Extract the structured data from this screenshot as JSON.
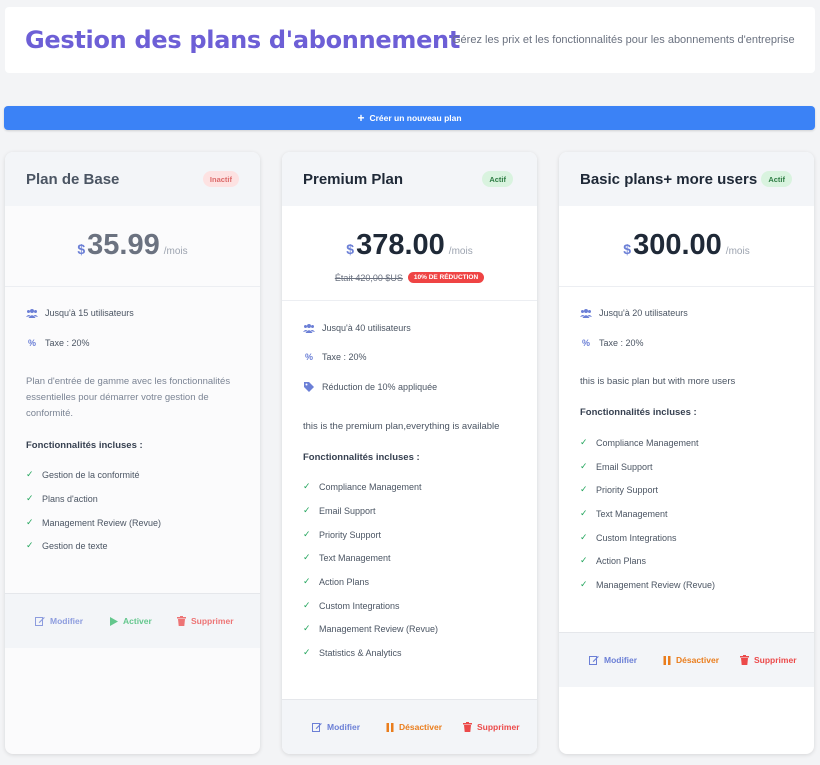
{
  "header": {
    "title": "Gestion des plans d'abonnement",
    "subtitle": "Gérez les prix et les fonctionnalités pour les abonnements d'entreprise"
  },
  "create_button": {
    "label": "Créer un nouveau plan",
    "icon": "plus-icon"
  },
  "labels": {
    "features_title": "Fonctionnalités incluses :",
    "edit": "Modifier",
    "activate": "Activer",
    "deactivate": "Désactiver",
    "delete": "Supprimer",
    "currency": "$",
    "per": "/mois"
  },
  "colors": {
    "accent": "#3b82f6",
    "title": "#6d5fd6",
    "active_badge": "#d9f3df",
    "inactive_badge": "#fde2e2",
    "discount": "#ef4444"
  },
  "plans": [
    {
      "name": "Plan de Base",
      "status": "Inactif",
      "price": "35.99",
      "users": "Jusqu'à 15 utilisateurs",
      "tax": "Taxe : 20%",
      "description": "Plan d'entrée de gamme avec les fonctionnalités essentielles pour démarrer votre gestion de conformité.",
      "features": [
        "Gestion de la conformité",
        "Plans d'action",
        "Management Review (Revue)",
        "Gestion de texte"
      ]
    },
    {
      "name": "Premium Plan",
      "status": "Actif",
      "price": "378.00",
      "old_price": "Était 420,00 $US",
      "discount_badge": "10% DE RÉDUCTION",
      "users": "Jusqu'à 40 utilisateurs",
      "tax": "Taxe : 20%",
      "discount_note": "Réduction de 10% appliquée",
      "description": "this is the premium plan,everything is available",
      "features": [
        "Compliance Management",
        "Email Support",
        "Priority Support",
        "Text Management",
        "Action Plans",
        "Custom Integrations",
        "Management Review (Revue)",
        "Statistics & Analytics"
      ]
    },
    {
      "name": "Basic plans+ more users",
      "status": "Actif",
      "price": "300.00",
      "users": "Jusqu'à 20 utilisateurs",
      "tax": "Taxe : 20%",
      "description": "this is basic plan but with more users",
      "features": [
        "Compliance Management",
        "Email Support",
        "Priority Support",
        "Text Management",
        "Custom Integrations",
        "Action Plans",
        "Management Review (Revue)"
      ]
    }
  ]
}
